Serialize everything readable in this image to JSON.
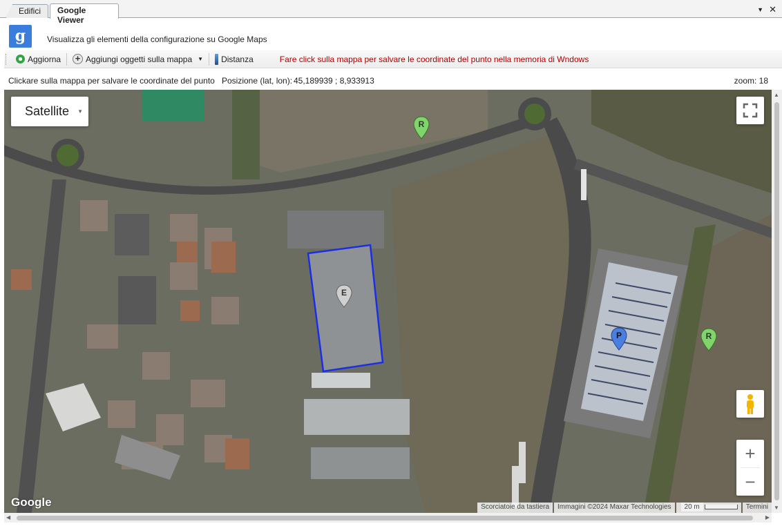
{
  "tabs": [
    {
      "label": "Edifici",
      "active": false
    },
    {
      "label": "Google Viewer",
      "active": true
    }
  ],
  "window_controls": {
    "dropdown_icon": "chevron-down-icon",
    "close_icon": "close-icon",
    "dropdown_glyph": "▼",
    "close_glyph": "✕"
  },
  "header": {
    "logo_letter": "g",
    "description": "Visualizza gli elementi della configurazione su Google Maps"
  },
  "toolbar": {
    "refresh_label": "Aggiorna",
    "add_objects_label": "Aggiungi oggetti sulla mappa",
    "distance_label": "Distanza",
    "hint": "Fare click sulla mappa per salvare le coordinate del punto nella memoria di Wndows"
  },
  "status": {
    "instruction": "Clickare sulla mappa per salvare le coordinate del punto",
    "position_label": "Posizione (lat, lon):",
    "position_value": "45,189939 ; 8,933913",
    "zoom_text": "zoom: 18"
  },
  "map": {
    "type_selector": "Satellite",
    "markers": [
      {
        "letter": "R",
        "color": "#7fd46a"
      },
      {
        "letter": "E",
        "color": "#cfcfcf"
      },
      {
        "letter": "P",
        "color": "#4a7fe0"
      },
      {
        "letter": "R",
        "color": "#7fd46a"
      }
    ],
    "zoom_in": "+",
    "zoom_out": "−",
    "logo": "Google",
    "attribution": {
      "shortcuts": "Scorciatoie da tastiera",
      "imagery": "Immagini ©2024 Maxar Technologies",
      "scale": "20 m",
      "terms": "Termini"
    },
    "outline_color": "#1a2ee6"
  }
}
